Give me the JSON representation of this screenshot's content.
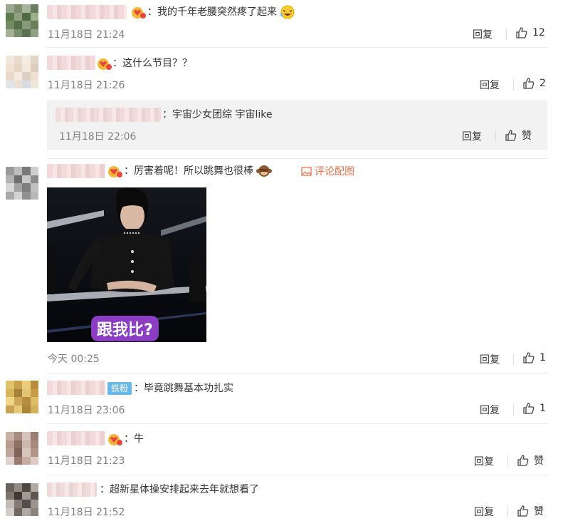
{
  "comments": [
    {
      "text": "：我的千年老腰突然疼了起来",
      "time": "11月18日 21:24",
      "reply": "回复",
      "likes": "12"
    },
    {
      "text": "：这什么节目？？",
      "time": "11月18日 21:26",
      "reply": "回复",
      "likes": "2",
      "sub_reply": {
        "text": "：宇宙少女团综  宇宙like",
        "time": "11月18日 22:06",
        "reply": "回复",
        "likes": "赞"
      }
    },
    {
      "text": "：厉害着呢！所以跳舞也很棒",
      "pic_link": "评论配图",
      "image_caption": "跟我比?",
      "time": "今天 00:25",
      "reply": "回复",
      "likes": "1"
    },
    {
      "badge": "铁粉",
      "text": "：毕竟跳舞基本功扎实",
      "time": "11月18日 23:06",
      "reply": "回复",
      "likes": "1"
    },
    {
      "text": "：牛",
      "time": "11月18日 21:23",
      "reply": "回复",
      "likes": "赞"
    },
    {
      "text": "：超新星体操安排起来去年就想看了",
      "time": "11月18日 21:52",
      "reply": "回复",
      "likes": "赞"
    }
  ],
  "colors": {
    "accent": "#eb7350",
    "fan_badge": "#69b7e8",
    "muted": "#808080"
  },
  "icons": [
    "thumbs-up-icon",
    "heart-face-vip-icon",
    "image-icon",
    "laughing-face-emoji",
    "monkey-emoji"
  ]
}
